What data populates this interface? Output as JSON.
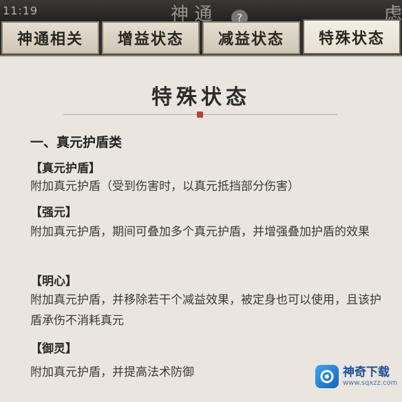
{
  "topbar": {
    "time": "11:19",
    "title": "神 通",
    "help_icon": "?",
    "corner_text": "虑"
  },
  "tabs": [
    {
      "label": "神通相关",
      "active": false
    },
    {
      "label": "增益状态",
      "active": false
    },
    {
      "label": "减益状态",
      "active": false
    },
    {
      "label": "特殊状态",
      "active": true
    }
  ],
  "panel": {
    "title": "特殊状态",
    "section_heading": "一、真元护盾类",
    "items": [
      {
        "name": "【真元护盾】",
        "desc": "附加真元护盾（受到伤害时，以真元抵挡部分伤害）"
      },
      {
        "name": "【强元】",
        "desc": "附加真元护盾，期间可叠加多个真元护盾，并增强叠加护盾的效果"
      },
      {
        "name": "【明心】",
        "desc": "附加真元护盾，并移除若干个减益效果，被定身也可以使用，且该护盾承伤不消耗真元"
      },
      {
        "name": "【御灵】",
        "desc": "附加真元护盾，并提高法术防御"
      }
    ]
  },
  "watermark": {
    "logo_icon": "swirl-logo",
    "name": "神奇下载",
    "url": "www.sqxzz.com"
  },
  "colors": {
    "panel_bg": "#eae6df",
    "tab_bg": "#d9d2c3",
    "accent_red": "#b5453a",
    "watermark_blue": "#1d4f9a"
  }
}
